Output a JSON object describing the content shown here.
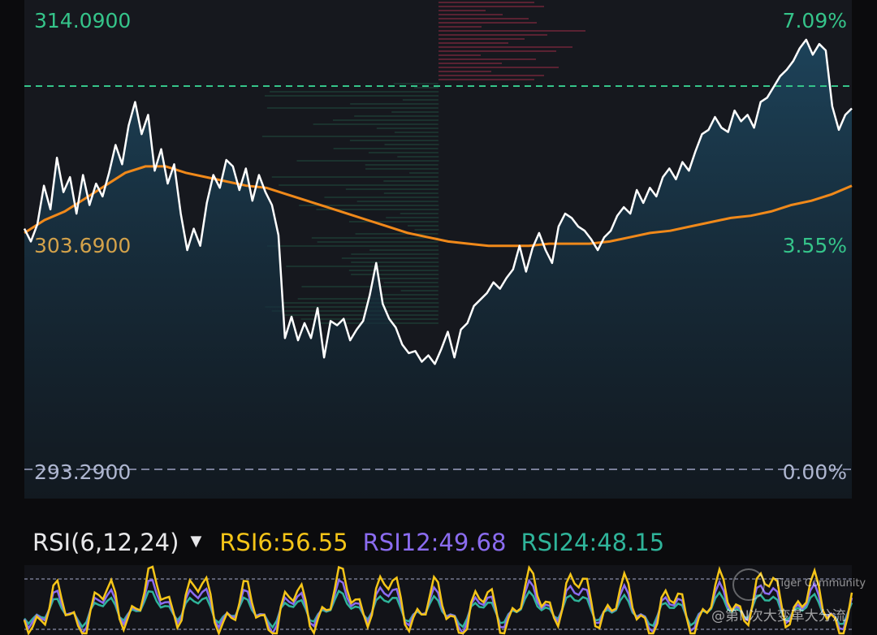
{
  "chart_data": [
    {
      "type": "line",
      "title": "",
      "ylim": [
        293.29,
        314.09
      ],
      "y_labels_left": [
        "314.0900",
        "303.6900",
        "293.2900"
      ],
      "y_labels_right": [
        "7.09%",
        "3.55%",
        "0.00%"
      ],
      "reference_price": 310.2,
      "series": [
        {
          "values": [
            304.5,
            303.9,
            304.7,
            306.5,
            305.4,
            307.8,
            306.2,
            306.9,
            305.2,
            307.0,
            305.6,
            306.6,
            306.0,
            307.1,
            308.4,
            307.5,
            309.3,
            310.4,
            308.9,
            309.8,
            307.2,
            308.2,
            306.6,
            307.5,
            305.2,
            303.5,
            304.5,
            303.7,
            305.7,
            307.0,
            306.4,
            307.7,
            307.4,
            306.3,
            307.3,
            305.8,
            307.0,
            306.2,
            305.6,
            304.2,
            299.4,
            300.4,
            299.3,
            300.1,
            299.4,
            300.8,
            298.5,
            300.2,
            300.0,
            300.3,
            299.3,
            299.8,
            300.2,
            301.4,
            302.9,
            301.0,
            300.3,
            299.9,
            299.1,
            298.7,
            298.8,
            298.3,
            298.6,
            298.2,
            298.9,
            299.7,
            298.5,
            299.8,
            300.1,
            300.9,
            301.2,
            301.5,
            302.0,
            301.7,
            302.2,
            302.6,
            303.7,
            302.5,
            303.6,
            304.3,
            303.5,
            302.9,
            304.6,
            305.2,
            305.0,
            304.6,
            304.4,
            304.0,
            303.5,
            304.1,
            304.4,
            305.1,
            305.5,
            305.2,
            306.3,
            305.7,
            306.4,
            306.0,
            306.9,
            307.3,
            306.8,
            307.6,
            307.2,
            308.1,
            308.9,
            309.1,
            309.7,
            309.2,
            309.0,
            310.0,
            309.5,
            309.8,
            309.2,
            310.4,
            310.6,
            311.1,
            311.6,
            311.9,
            312.3,
            312.9,
            313.3,
            312.6,
            313.1,
            312.8,
            310.2,
            309.1,
            309.8,
            310.1
          ]
        },
        {
          "name": "",
          "values": [
            304.3,
            304.9,
            305.3,
            305.9,
            306.5,
            307.1,
            307.4,
            307.4,
            307.1,
            306.9,
            306.7,
            306.5,
            306.4,
            306.1,
            305.8,
            305.5,
            305.2,
            304.9,
            304.6,
            304.3,
            304.1,
            303.9,
            303.8,
            303.7,
            303.7,
            303.7,
            303.8,
            303.8,
            303.8,
            303.9,
            304.1,
            304.3,
            304.4,
            304.6,
            304.8,
            305.0,
            305.1,
            305.3,
            305.6,
            305.8,
            306.1,
            306.5
          ]
        }
      ]
    },
    {
      "type": "line",
      "title": "RSI(6,12,24)",
      "series": [
        {
          "name": "RSI6",
          "value_label": "56.55",
          "last": 56.55
        },
        {
          "name": "RSI12",
          "value_label": "49.68",
          "last": 49.68
        },
        {
          "name": "RSI24",
          "value_label": "48.15",
          "last": 48.15
        }
      ]
    }
  ],
  "rsi_header": {
    "name": "RSI(6,12,24)",
    "caret": "▼",
    "rsi6_text": "RSI6:56.55",
    "rsi12_text": "RSI12:49.68",
    "rsi24_text": "RSI24:48.15"
  },
  "watermark": {
    "brand": "Tiger Community",
    "user": "@第N次大变革大分流"
  },
  "colors": {
    "price_line": "#ffffff",
    "moving_average": "#f0891a",
    "reference_dash": "#35c48a",
    "rsi6": "#f5c518",
    "rsi12": "#8b6cf0",
    "rsi24": "#2fb49a",
    "label_green": "#35c48a",
    "label_neutral": "#aeb6d0",
    "vp_upper": "#6b2637",
    "vp_lower": "#1d3a32"
  }
}
